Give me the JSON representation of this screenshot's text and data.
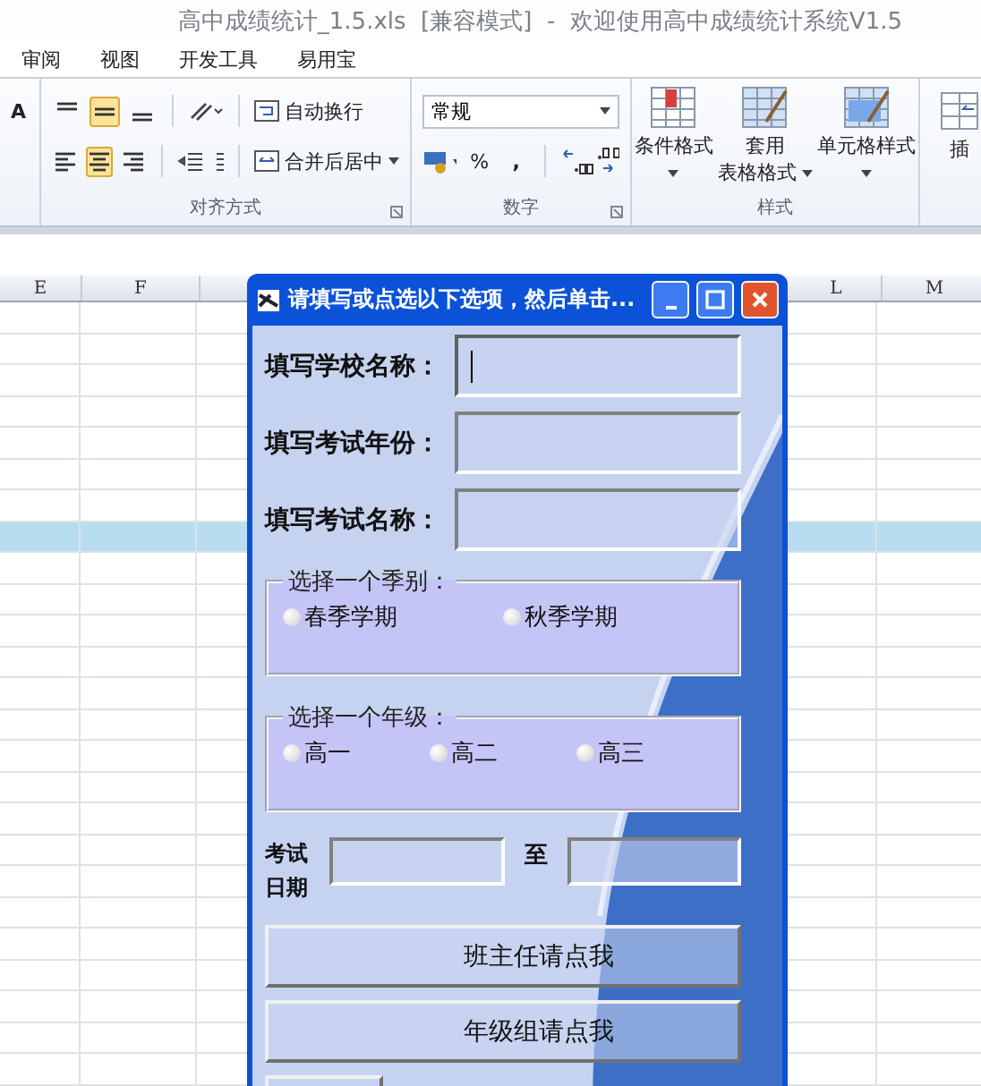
{
  "app_title": "高中成绩统计_1.5.xls  [兼容模式]  -  欢迎使用高中成绩统计系统V1.5",
  "menu": [
    "审阅",
    "视图",
    "开发工具",
    "易用宝"
  ],
  "ribbon": {
    "alignment": {
      "label": "对齐方式",
      "align_buttons": [
        {
          "selected": false
        },
        {
          "selected": true
        },
        {
          "selected": false
        },
        {
          "selected": false
        },
        {
          "selected": true
        },
        {
          "selected": false
        }
      ],
      "wrap_text": "自动换行",
      "merge_center": "合并后居中"
    },
    "number": {
      "label": "数字",
      "format": "常规",
      "percent": "%",
      "comma": ","
    },
    "styles": {
      "label": "样式",
      "buttons": [
        {
          "lines": [
            "条件格式"
          ]
        },
        {
          "lines": [
            "套用",
            "表格格式"
          ]
        },
        {
          "lines": [
            "单元格样式"
          ]
        }
      ]
    },
    "insert": {
      "label": "插"
    },
    "font": {
      "label": "A"
    }
  },
  "sheet": {
    "columns": [
      "E",
      "F",
      "L",
      "M"
    ],
    "rows": [
      {
        "selected": false
      },
      {
        "selected": false
      },
      {
        "selected": false
      },
      {
        "selected": false
      },
      {
        "selected": false
      },
      {
        "selected": false
      },
      {
        "selected": false
      },
      {
        "selected": true
      },
      {
        "selected": false
      },
      {
        "selected": false
      },
      {
        "selected": false
      },
      {
        "selected": false
      },
      {
        "selected": false
      },
      {
        "selected": false
      },
      {
        "selected": false
      },
      {
        "selected": false
      },
      {
        "selected": false
      },
      {
        "selected": false
      },
      {
        "selected": false
      },
      {
        "selected": false
      },
      {
        "selected": false
      },
      {
        "selected": false
      },
      {
        "selected": false
      },
      {
        "selected": false
      },
      {
        "selected": false
      }
    ]
  },
  "dialog": {
    "title": "请填写或点选以下选项，然后单击...",
    "fields": [
      {
        "label": "填写学校名称：",
        "focused": true
      },
      {
        "label": "填写考试年份：",
        "focused": false
      },
      {
        "label": "填写考试名称：",
        "focused": false
      }
    ],
    "groups": [
      {
        "title": "选择一个季别：",
        "options": [
          {
            "label": "春季学期",
            "selected": false
          },
          {
            "label": "秋季学期",
            "selected": false
          }
        ]
      },
      {
        "title": "选择一个年级：",
        "options": [
          {
            "label": "高一",
            "selected": false
          },
          {
            "label": "高二",
            "selected": false
          },
          {
            "label": "高三",
            "selected": false
          }
        ]
      }
    ],
    "date": {
      "label": "考试日期",
      "to": "至"
    },
    "buttons": [
      "班主任请点我",
      "年级组请点我"
    ]
  }
}
